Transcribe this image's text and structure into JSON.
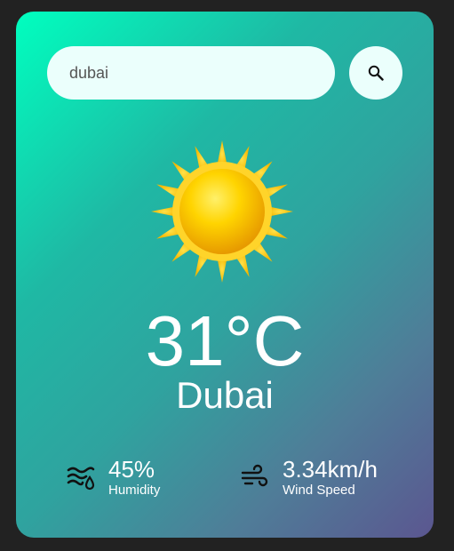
{
  "search": {
    "value": "dubai",
    "placeholder": "Enter city name"
  },
  "search_button_icon": "search-icon",
  "weather": {
    "icon": "sun-icon",
    "temperature": "31°C",
    "city": "Dubai"
  },
  "details": {
    "humidity": {
      "value": "45%",
      "label": "Humidity",
      "icon": "humidity-icon"
    },
    "wind": {
      "value": "3.34km/h",
      "label": "Wind Speed",
      "icon": "wind-icon"
    }
  },
  "colors": {
    "background": "#222222",
    "gradient_start": "#00ffbf",
    "gradient_end": "#5b5690",
    "input_bg": "#ebfffc",
    "text": "#ffffff"
  }
}
